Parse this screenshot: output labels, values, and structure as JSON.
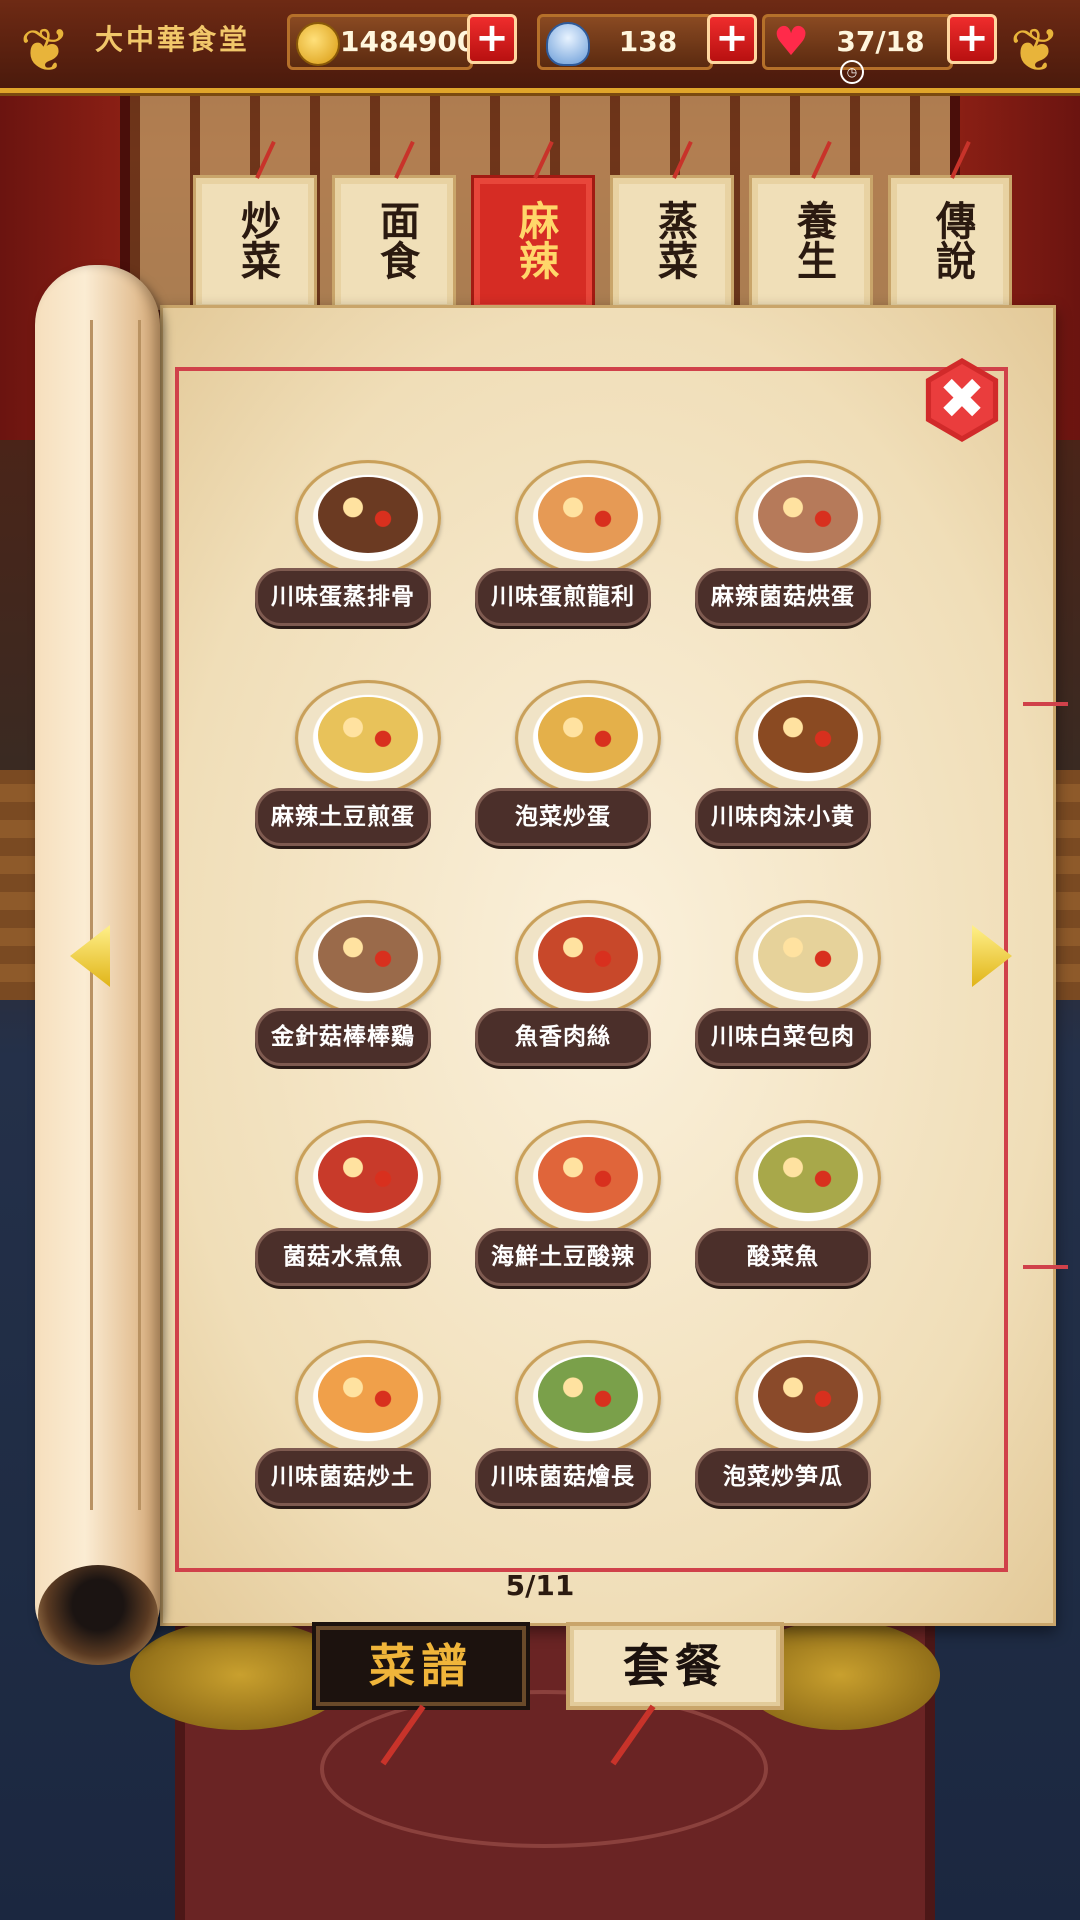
{
  "header": {
    "shop_name": "大中華食堂",
    "gold": "1484900",
    "ingot": "138",
    "stamina": "37/18",
    "plus_symbol": "+"
  },
  "tabs": [
    {
      "label": "炒菜",
      "active": false
    },
    {
      "label": "面食",
      "active": false
    },
    {
      "label": "麻辣",
      "active": true
    },
    {
      "label": "蒸菜",
      "active": false
    },
    {
      "label": "養生",
      "active": false
    },
    {
      "label": "傳說",
      "active": false
    }
  ],
  "recipes": [
    {
      "name": "川味蛋蒸排骨",
      "color": "#6b3a22"
    },
    {
      "name": "川味蛋煎龍利",
      "color": "#e69a55"
    },
    {
      "name": "麻辣菌菇烘蛋",
      "color": "#b67a5a"
    },
    {
      "name": "麻辣土豆煎蛋",
      "color": "#e8c25a"
    },
    {
      "name": "泡菜炒蛋",
      "color": "#e4b04a"
    },
    {
      "name": "川味肉沫小黄",
      "color": "#8a4a22"
    },
    {
      "name": "金針菇棒棒鷄",
      "color": "#9a6a4a"
    },
    {
      "name": "魚香肉絲",
      "color": "#c8482a"
    },
    {
      "name": "川味白菜包肉",
      "color": "#e6d29a"
    },
    {
      "name": "菌菇水煮魚",
      "color": "#c83a2a"
    },
    {
      "name": "海鮮土豆酸辣",
      "color": "#e0653a"
    },
    {
      "name": "酸菜魚",
      "color": "#a8a84a"
    },
    {
      "name": "川味菌菇炒土",
      "color": "#f0a04a"
    },
    {
      "name": "川味菌菇燴長",
      "color": "#7aa04a"
    },
    {
      "name": "泡菜炒笋瓜",
      "color": "#8a4a2a"
    }
  ],
  "pager": "5/11",
  "bottom": {
    "recipe_label": "菜譜",
    "set_label": "套餐"
  },
  "colors": {
    "active_tab": "#d62c24",
    "frame_red": "#d0414a",
    "label_bg": "#4b2f2a"
  }
}
